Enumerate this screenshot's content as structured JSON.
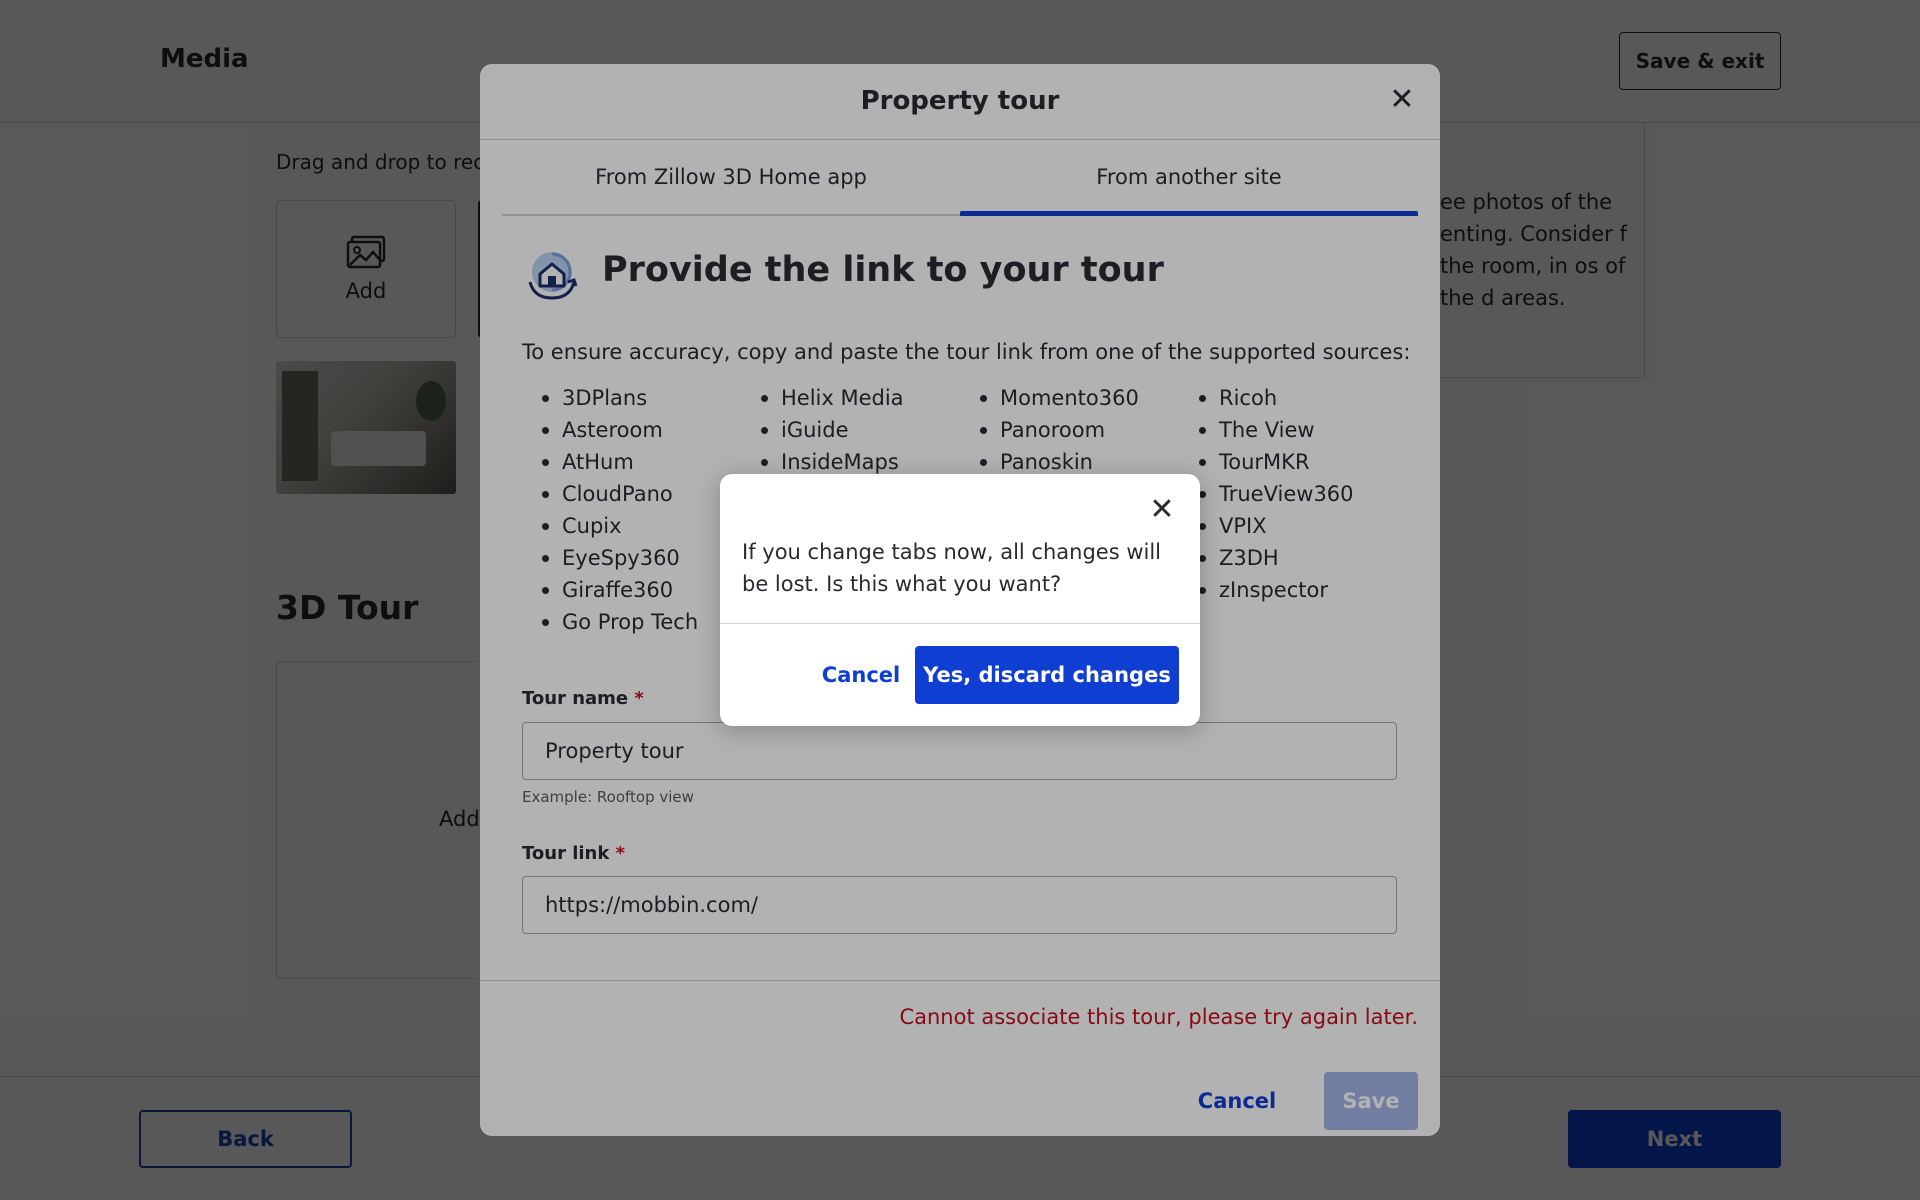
{
  "page": {
    "title": "Media",
    "save_exit_label": "Save & exit",
    "drag_drop_text": "Drag and drop to reo",
    "add_photo_label": "Add",
    "tips_text": "ee photos of the enting. Consider f the room, in os of the d areas.",
    "tour_section_title": "3D Tour",
    "tour_add_label": "Add",
    "back_label": "Back",
    "next_label": "Next"
  },
  "modal": {
    "title": "Property tour",
    "tabs": [
      {
        "label": "From Zillow 3D Home app",
        "active": false
      },
      {
        "label": "From another site",
        "active": true
      }
    ],
    "heading": "Provide the link to your tour",
    "intro": "To ensure accuracy, copy and paste the tour link from one of the supported sources:",
    "sources_columns": [
      [
        "3DPlans",
        "Asteroom",
        "AtHum",
        "CloudPano",
        "Cupix",
        "EyeSpy360",
        "Giraffe360",
        "Go Prop Tech"
      ],
      [
        "Helix Media",
        "iGuide",
        "InsideMaps"
      ],
      [
        "Momento360",
        "Panoroom",
        "Panoskin"
      ],
      [
        "Ricoh",
        "The View",
        "TourMKR",
        "TrueView360",
        "VPIX",
        "Z3DH",
        "zInspector"
      ]
    ],
    "tour_name": {
      "label": "Tour name",
      "required_mark": "*",
      "value": "Property tour",
      "hint": "Example: Rooftop view"
    },
    "tour_link": {
      "label": "Tour link",
      "required_mark": "*",
      "value": "https://mobbin.com/"
    },
    "error": "Cannot associate this tour, please try again later.",
    "cancel_label": "Cancel",
    "save_label": "Save"
  },
  "confirm": {
    "message": "If you change tabs now, all changes will be lost. Is this what you want?",
    "cancel_label": "Cancel",
    "confirm_label": "Yes, discard changes"
  },
  "colors": {
    "accent": "#0f3ed2",
    "error": "#c0101f",
    "text": "#2a2a33"
  },
  "icons": {
    "close": "close-icon",
    "image": "image-icon",
    "tour_link": "tour-link-icon"
  }
}
